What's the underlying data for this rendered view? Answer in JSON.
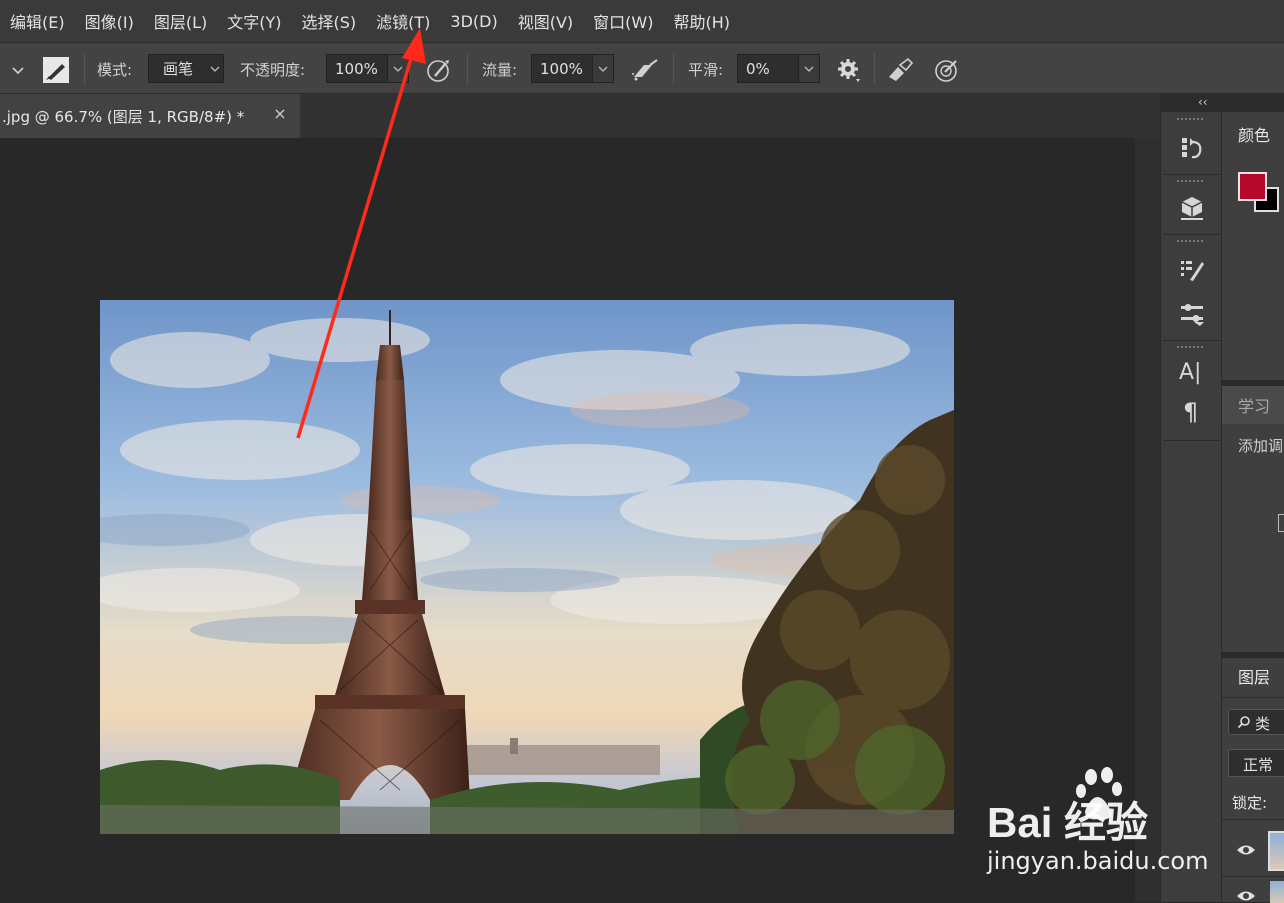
{
  "menu": [
    "编辑(E)",
    "图像(I)",
    "图层(L)",
    "文字(Y)",
    "选择(S)",
    "滤镜(T)",
    "3D(D)",
    "视图(V)",
    "窗口(W)",
    "帮助(H)"
  ],
  "options": {
    "mode_label": "模式:",
    "mode_value": "画笔",
    "opacity_label": "不透明度:",
    "opacity_value": "100%",
    "flow_label": "流量:",
    "flow_value": "100%",
    "smooth_label": "平滑:",
    "smooth_value": "0%"
  },
  "document": {
    "tab_title": ".jpg @ 66.7% (图层 1, RGB/8#) *",
    "close_glyph": "×"
  },
  "panels": {
    "collapse_glyph": "‹‹",
    "color_title": "颜色",
    "learn_title": "学习",
    "learn_body": "添加调",
    "layers_title": "图层",
    "layers_search": "类",
    "blend_mode": "正常",
    "lock_label": "锁定:",
    "type_tool_glyph": "A|",
    "paragraph_glyph": "¶",
    "foreground_color": "#b5082a",
    "background_color": "#000000"
  },
  "watermark": {
    "brand": "Bai  经验",
    "url": "jingyan.baidu.com"
  },
  "annotation": {
    "arrow_color": "#ff2a1a"
  }
}
